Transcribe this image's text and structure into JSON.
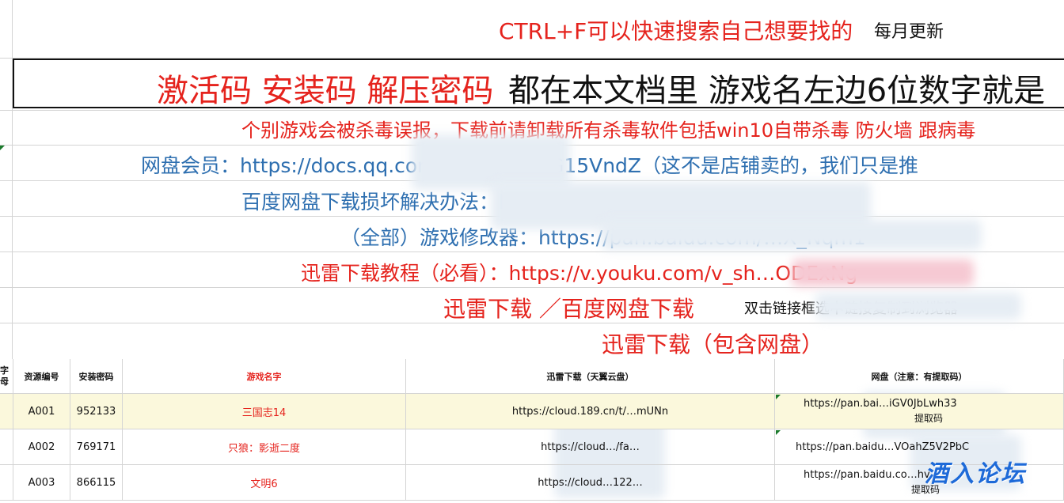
{
  "header": {
    "ctrl_f": "CTRL+F可以快速搜索自己想要找的",
    "monthly": "每月更新"
  },
  "banner": {
    "red": "激活码 安装码 解压密码",
    "black": "都在本文档里 游戏名左边6位数字就是"
  },
  "notices": [
    {
      "text": "个别游戏会被杀毒误报，下载前请卸载所有杀毒软件包括win10自带杀毒 防火墙 跟病毒",
      "color": "#e5231d"
    },
    {
      "text": "网盘会员：https://docs.qq.com/…HdWRnaG15VndZ（这不是店铺卖的，我们只是推",
      "color": "#2e6fb0"
    },
    {
      "text": "百度网盘下载损坏解决办法：h…33a65",
      "color": "#2e6fb0"
    },
    {
      "text": "（全部）游戏修改器：https://pan.baidu.com/…X_Nqm1",
      "color": "#2e6fb0"
    },
    {
      "text": "迅雷下载教程（必看）：https://v.youku.com/v_sh…ODExNg",
      "color": "#e5231d"
    }
  ],
  "download_line": {
    "red": "迅雷下载 ／百度网盘下载",
    "black": "双击链接框选中链接复制到浏览器"
  },
  "include_line": "迅雷下载（包含网盘）",
  "table": {
    "headers": [
      "字母",
      "资源编号",
      "安装密码",
      "游戏名字",
      "迅雷下载（天翼云盘）",
      "网盘（注意：有提取码）"
    ],
    "rows": [
      {
        "id": "A001",
        "pwd": "952133",
        "name": "三国志14",
        "xunlei": "https://cloud.189.cn/t/…mUNn",
        "pan": "https://pan.bai…iGV0JbLwh33",
        "pan2": "提取码"
      },
      {
        "id": "A002",
        "pwd": "769171",
        "name": "只狼：影逝二度",
        "xunlei": "https://cloud…/fa…",
        "pan": "https://pan.baidu…VOahZ5V2PbC",
        "pan2": ""
      },
      {
        "id": "A003",
        "pwd": "866115",
        "name": "文明6",
        "xunlei": "https://cloud…122…",
        "pan": "https://pan.baidu.co…hv",
        "pan2": "提取码"
      }
    ]
  },
  "watermark": "酒入论坛"
}
